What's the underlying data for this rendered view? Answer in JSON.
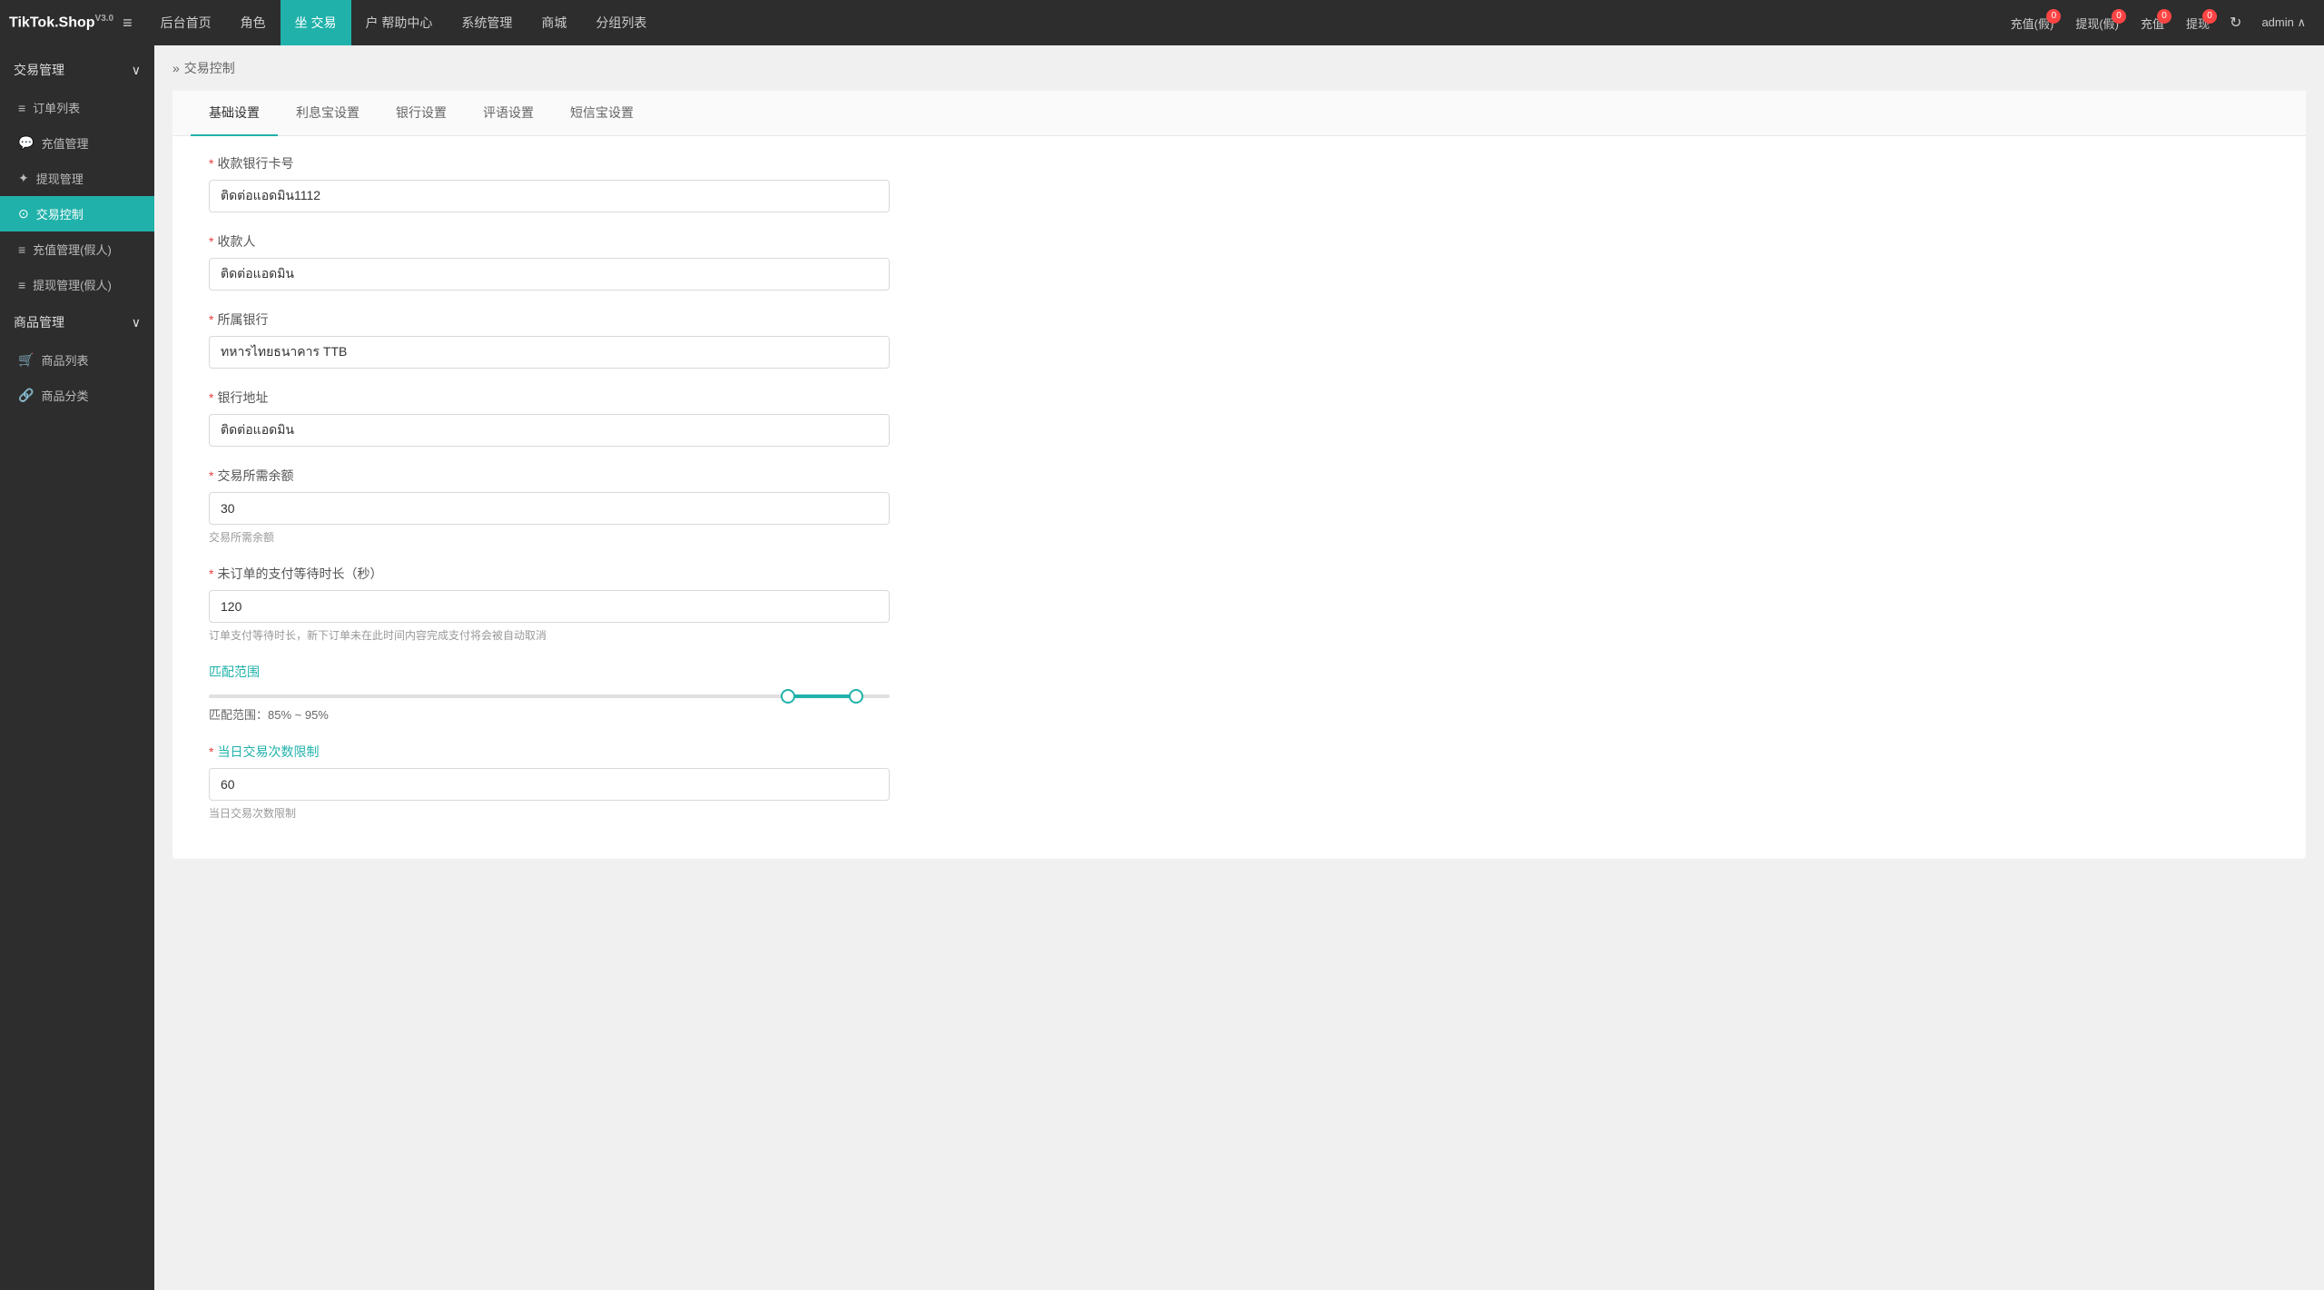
{
  "app": {
    "name": "TikTok.Shop",
    "version": "V3.0"
  },
  "topNav": {
    "menu_icon": "≡",
    "items": [
      {
        "id": "home",
        "label": "后台首页",
        "active": false
      },
      {
        "id": "role",
        "label": "角色",
        "active": false
      },
      {
        "id": "trade",
        "label": "坐 交易",
        "active": true
      },
      {
        "id": "help",
        "label": "户 帮助中心",
        "active": false
      },
      {
        "id": "system",
        "label": "系统管理",
        "active": false
      },
      {
        "id": "shop",
        "label": "商城",
        "active": false
      },
      {
        "id": "grouplist",
        "label": "分组列表",
        "active": false
      }
    ],
    "right_buttons": [
      {
        "id": "recharge-fake",
        "label": "充值(假)",
        "badge": "0"
      },
      {
        "id": "withdraw-fake",
        "label": "提现(假)",
        "badge": "0"
      },
      {
        "id": "recharge",
        "label": "充值",
        "badge": "0"
      },
      {
        "id": "withdraw",
        "label": "提现",
        "badge": "0"
      }
    ],
    "refresh_icon": "↻",
    "admin_label": "admin ∧"
  },
  "sidebar": {
    "sections": [
      {
        "id": "trade-mgmt",
        "label": "交易管理",
        "collapsed": false,
        "items": [
          {
            "id": "order-list",
            "label": "订单列表",
            "icon": "≡",
            "active": false
          },
          {
            "id": "recharge-mgmt",
            "label": "充值管理",
            "icon": "💬",
            "active": false
          },
          {
            "id": "withdraw-mgmt",
            "label": "提现管理",
            "icon": "✦",
            "active": false
          },
          {
            "id": "trade-control",
            "label": "交易控制",
            "icon": "⊙",
            "active": true
          },
          {
            "id": "recharge-fake",
            "label": "充值管理(假人)",
            "icon": "≡",
            "active": false
          },
          {
            "id": "withdraw-fake",
            "label": "提现管理(假人)",
            "icon": "≡",
            "active": false
          }
        ]
      },
      {
        "id": "product-mgmt",
        "label": "商品管理",
        "collapsed": false,
        "items": [
          {
            "id": "product-list",
            "label": "商品列表",
            "icon": "🛒",
            "active": false
          },
          {
            "id": "product-category",
            "label": "商品分类",
            "icon": "🔗",
            "active": false
          }
        ]
      }
    ]
  },
  "breadcrumb": {
    "arrow": "»",
    "text": "交易控制"
  },
  "tabs": [
    {
      "id": "basic",
      "label": "基础设置",
      "active": true
    },
    {
      "id": "alipay",
      "label": "利息宝设置",
      "active": false
    },
    {
      "id": "bank",
      "label": "银行设置",
      "active": false
    },
    {
      "id": "review",
      "label": "评语设置",
      "active": false
    },
    {
      "id": "sms",
      "label": "短信宝设置",
      "active": false
    }
  ],
  "form": {
    "fields": [
      {
        "id": "bank-card",
        "label": "收款银行卡号",
        "required": true,
        "value": "ติดต่อแอดมิน1112",
        "hint": ""
      },
      {
        "id": "payee",
        "label": "收款人",
        "required": true,
        "value": "ติดต่อแอดมิน",
        "hint": ""
      },
      {
        "id": "bank-name",
        "label": "所属银行",
        "required": true,
        "value": "ทหารไทยธนาคาร TTB",
        "hint": ""
      },
      {
        "id": "bank-address",
        "label": "银行地址",
        "required": true,
        "value": "ติดต่อแอดมิน",
        "hint": ""
      },
      {
        "id": "trade-balance",
        "label": "交易所需余额",
        "required": true,
        "value": "30",
        "hint": "交易所需余额"
      },
      {
        "id": "payment-timeout",
        "label": "未订单的支付等待时长（秒）",
        "required": true,
        "value": "120",
        "hint": "订单支付等待时长，新下订单未在此时间内容完成支付将会被自动取消"
      }
    ],
    "slider": {
      "label": "匹配范围",
      "hint": "匹配范围：85% ~ 95%",
      "min": 0,
      "max": 100,
      "left_value": 85,
      "right_value": 95
    },
    "daily_limit": {
      "label": "当日交易次数限制",
      "required": true,
      "value": "60",
      "hint": "当日交易次数限制"
    }
  }
}
